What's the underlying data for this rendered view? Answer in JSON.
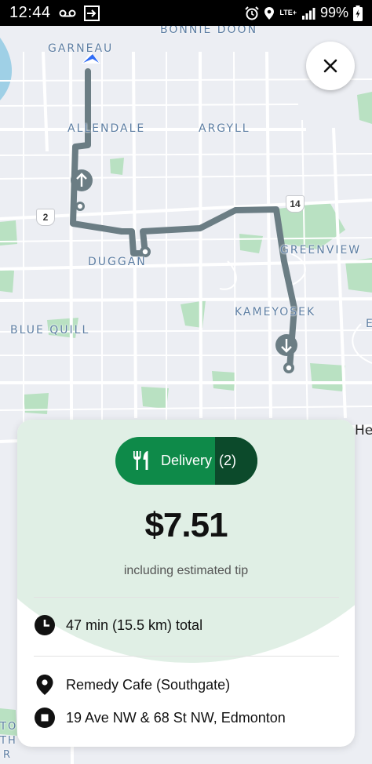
{
  "status_bar": {
    "time": "12:44",
    "network": "LTE+",
    "battery": "99%",
    "icons": [
      "voicemail-icon",
      "cast-icon",
      "alarm-icon",
      "location-icon",
      "signal-icon",
      "battery-charging-icon"
    ]
  },
  "map": {
    "labels": [
      "GARNEAU",
      "BONNIE DOON",
      "ALLENDALE",
      "ARGYLL",
      "DUGGAN",
      "GREENVIEW",
      "KAMEYOSEK",
      "BLUE QUILL",
      "He",
      "E",
      "TO",
      "TH",
      "R"
    ],
    "highway_shields": [
      "2",
      "14"
    ],
    "colors": {
      "route": "#6b7d84",
      "start_marker": "#2f6cf6",
      "park": "#b9e1c2",
      "road": "#ffffff",
      "water": "#9fd0e6"
    },
    "markers": [
      "start-arrow-icon",
      "up-arrow-icon",
      "down-arrow-icon"
    ]
  },
  "close_button": {
    "icon": "close-icon"
  },
  "offer": {
    "type_label": "Delivery",
    "count": "(2)",
    "icon": "fork-knife-icon",
    "price": "$7.51",
    "subtitle": "including estimated tip",
    "duration": "47 min (15.5 km) total",
    "pickup": "Remedy Cafe (Southgate)",
    "dropoff": "19 Ave NW & 68 St NW, Edmonton",
    "colors": {
      "pill": "#0e8a49",
      "pill_dark": "#0c4a2b",
      "glow": "#e0efe5"
    }
  }
}
